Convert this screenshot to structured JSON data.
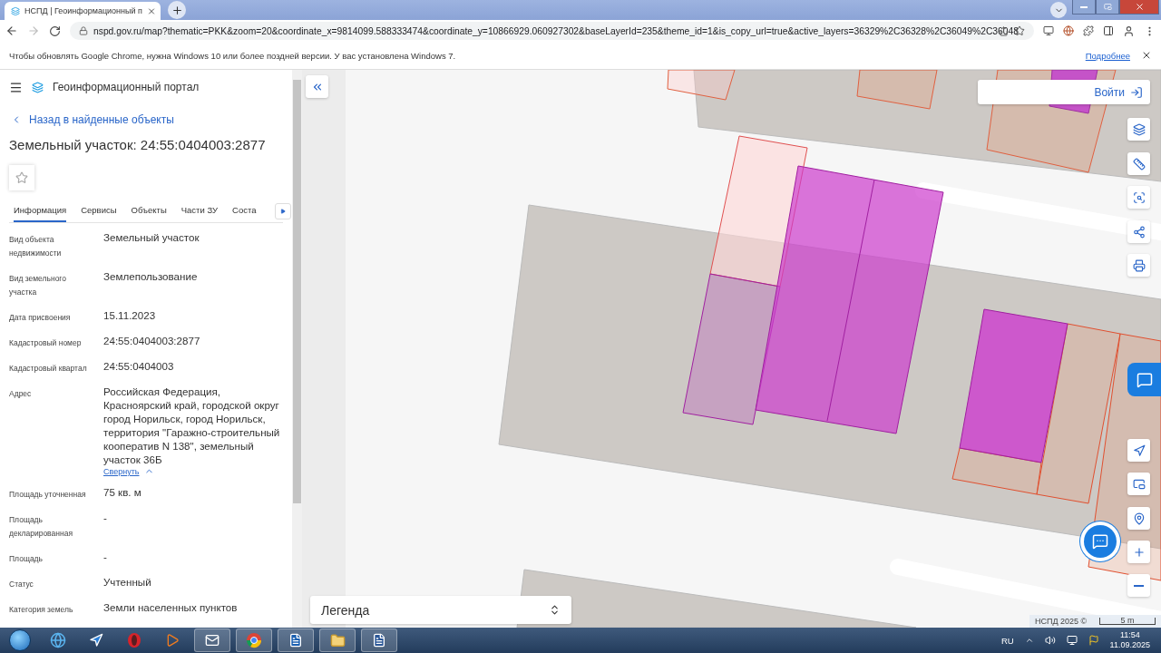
{
  "browser": {
    "tab_title": "НСПД | Геоинформационный п",
    "url": "nspd.gov.ru/map?thematic=PKK&zoom=20&coordinate_x=9814099.588333474&coordinate_y=10866929.060927302&baseLayerId=235&theme_id=1&is_copy_url=true&active_layers=36329%2C36328%2C36049%2C36048"
  },
  "infobar": {
    "message": "Чтобы обновлять Google Chrome, нужна Windows 10 или более поздней версии. У вас установлена Windows 7.",
    "link": "Подробнее"
  },
  "panel": {
    "app_title": "Геоинформационный портал",
    "back_link": "Назад в найденные объекты",
    "title": "Земельный участок: 24:55:0404003:2877",
    "tabs": [
      {
        "label": "Информация",
        "selected": true
      },
      {
        "label": "Сервисы",
        "selected": false
      },
      {
        "label": "Объекты",
        "selected": false
      },
      {
        "label": "Части ЗУ",
        "selected": false
      },
      {
        "label": "Соста",
        "selected": false
      }
    ],
    "fields": [
      {
        "label": "Вид объекта недвижимости",
        "value": "Земельный участок"
      },
      {
        "label": "Вид земельного участка",
        "value": "Землепользование"
      },
      {
        "label": "Дата присвоения",
        "value": "15.11.2023"
      },
      {
        "label": "Кадастровый номер",
        "value": "24:55:0404003:2877"
      },
      {
        "label": "Кадастровый квартал",
        "value": "24:55:0404003"
      },
      {
        "label": "Адрес",
        "value": "Российская Федерация, Красноярский край, городской округ город Норильск, город Норильск, территория \"Гаражно-строительный кооператив N 138\", земельный участок 36Б",
        "toggle": "Свернуть"
      },
      {
        "label": "Площадь уточненная",
        "value": "75 кв. м"
      },
      {
        "label": "Площадь декларированная",
        "value": "-"
      },
      {
        "label": "Площадь",
        "value": "-"
      },
      {
        "label": "Статус",
        "value": "Учтенный"
      },
      {
        "label": "Категория земель",
        "value": "Земли населенных пунктов"
      }
    ]
  },
  "map": {
    "login": "Войти",
    "legend": "Легенда",
    "copyright": "НСПД 2025 ©",
    "scale": "5 m"
  },
  "taskbar": {
    "language": "RU",
    "time": "11:54",
    "date": "11.09.2025"
  }
}
